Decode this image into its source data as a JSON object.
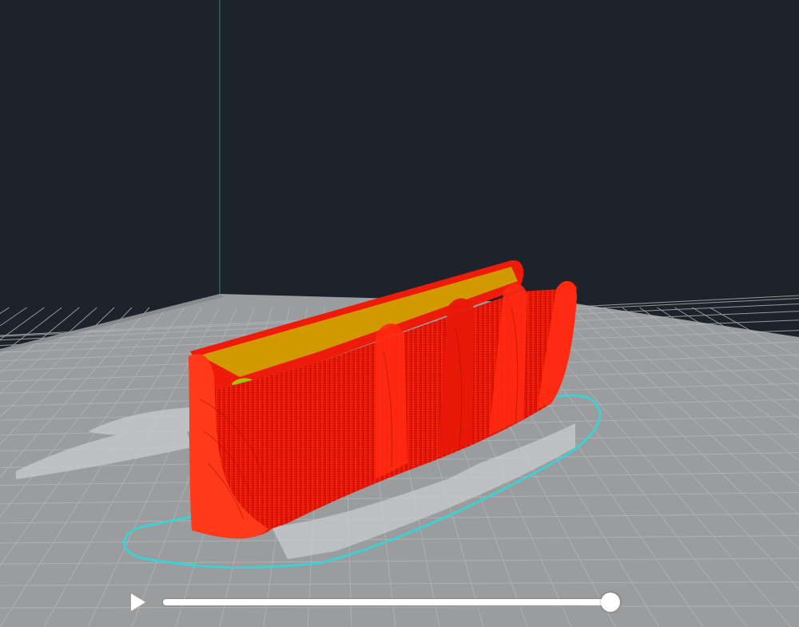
{
  "viewport": {
    "background_color": "#1d232a",
    "build_plate_color": "#9a9c9e",
    "grid_line_color": "#b4b6b8",
    "model_color": "#ee1a0a",
    "model_infill_color": "#c8c400",
    "brim_color": "#3fd0d4"
  },
  "simulation": {
    "play_icon": "play-icon",
    "progress": 1.0
  }
}
